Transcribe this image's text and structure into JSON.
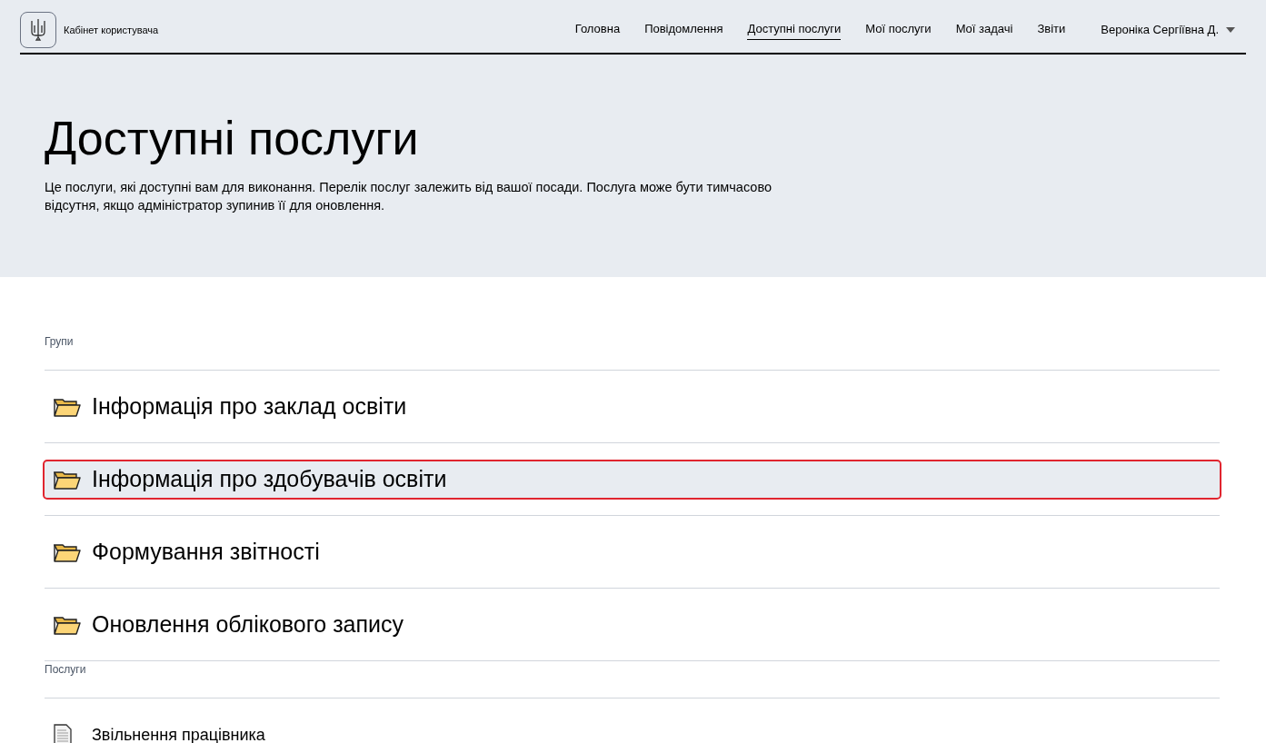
{
  "header": {
    "logo_text": "Кабінет користувача",
    "nav": [
      {
        "label": "Головна",
        "selected": false
      },
      {
        "label": "Повідомлення",
        "selected": false
      },
      {
        "label": "Доступні послуги",
        "selected": true
      },
      {
        "label": "Мої послуги",
        "selected": false
      },
      {
        "label": "Мої задачі",
        "selected": false
      },
      {
        "label": "Звіти",
        "selected": false
      }
    ],
    "user": "Вероніка Сергіївна Д."
  },
  "hero": {
    "title": "Доступні послуги",
    "description": "Це послуги, які доступні вам для виконання. Перелік послуг залежить від вашої посади. Послуга може бути тимчасово відсутня, якщо адміністратор зупинив її для оновлення."
  },
  "sections": [
    {
      "heading": "Групи",
      "items": [
        {
          "kind": "folder",
          "label": "Інформація про заклад освіти",
          "selected": false
        },
        {
          "kind": "folder",
          "label": "Інформація про здобувачів освіти",
          "selected": true
        },
        {
          "kind": "folder",
          "label": "Формування звітності",
          "selected": false
        },
        {
          "kind": "folder",
          "label": "Оновлення облікового запису",
          "selected": false
        }
      ]
    },
    {
      "heading": "Послуги",
      "items": [
        {
          "kind": "document",
          "label": "Звільнення працівника",
          "selected": false
        }
      ]
    }
  ]
}
